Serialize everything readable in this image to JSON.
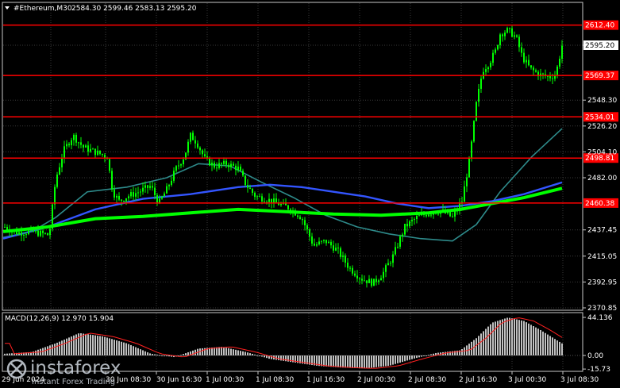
{
  "header": {
    "symbol": "#Ethereum,M30",
    "ohlc": "2584.30 2599.46 2583.13 2595.20"
  },
  "price_axis": {
    "ticks": [
      "2595.20",
      "2548.30",
      "2526.20",
      "2504.10",
      "2482.00",
      "2437.45",
      "2415.05",
      "2392.95",
      "2370.85"
    ],
    "current_price": "2595.20"
  },
  "levels": [
    {
      "label": "2612.40",
      "value": 2612.4
    },
    {
      "label": "2569.37",
      "value": 2569.37
    },
    {
      "label": "2534.01",
      "value": 2534.01
    },
    {
      "label": "2498.81",
      "value": 2498.81
    },
    {
      "label": "2460.38",
      "value": 2460.38
    }
  ],
  "time_axis": [
    "29 Jun 2024",
    "30 Jun 08:30",
    "30 Jun 16:30",
    "1 Jul 00:30",
    "1 Jul 08:30",
    "1 Jul 16:30",
    "2 Jul 00:30",
    "2 Jul 08:30",
    "2 Jul 16:30",
    "3 Jul 00:30",
    "3 Jul 08:30"
  ],
  "macd": {
    "label": "MACD(12,26,9) 12.970 15.904",
    "ticks": [
      "44.136",
      "0.00",
      "-15.73"
    ]
  },
  "watermark": {
    "brand": "instaforex",
    "tagline": "Instant Forex Trading"
  },
  "colors": {
    "background": "#000000",
    "candle": "#00ff00",
    "level_line": "#ff0000",
    "ma_fast": "#2e8b8b",
    "ma_mid": "#3355ff",
    "ma_slow": "#00ff00",
    "macd_hist": "#c0c0c0",
    "macd_signal": "#ff2020"
  }
}
